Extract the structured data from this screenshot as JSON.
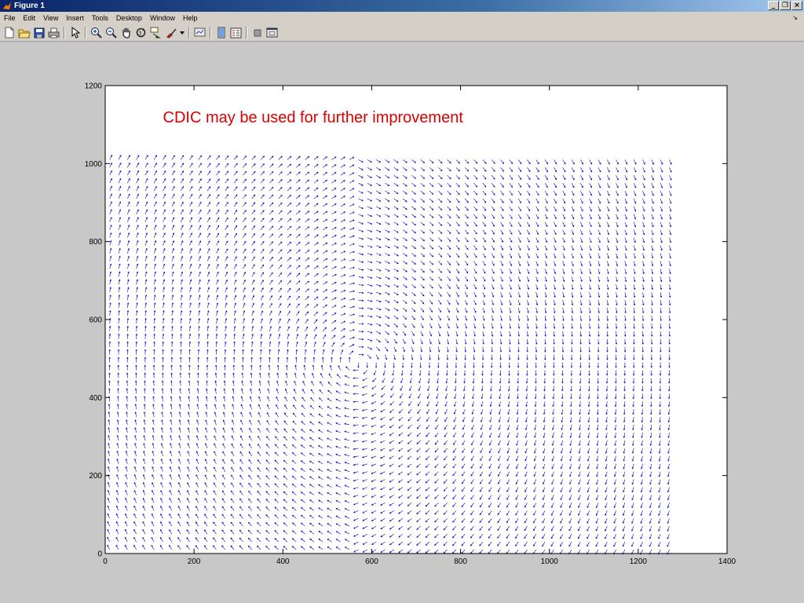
{
  "window": {
    "title": "Figure 1",
    "buttons": [
      "_",
      "❐",
      "×"
    ]
  },
  "menubar": {
    "items": [
      "File",
      "Edit",
      "View",
      "Insert",
      "Tools",
      "Desktop",
      "Window",
      "Help"
    ],
    "overflow_glyph": "↘"
  },
  "toolbar": {
    "buttons": [
      "new-figure-icon",
      "open-file-icon",
      "save-icon",
      "print-icon",
      "pointer-icon",
      "zoom-in-icon",
      "zoom-out-icon",
      "pan-hand-icon",
      "rotate-3d-icon",
      "data-cursor-icon",
      "brush-icon",
      "link-plot-icon",
      "colorbar-icon",
      "legend-icon",
      "hide-plot-tools-icon",
      "show-plot-tools-icon"
    ]
  },
  "colors": {
    "vectors": "#0000cc",
    "annotation": "#dd0000",
    "figure_bg": "#c8c8c8",
    "axes_bg": "#ffffff"
  },
  "chart_data": {
    "type": "quiver",
    "title": "",
    "xlabel": "",
    "ylabel": "",
    "xlim": [
      0,
      1400
    ],
    "ylim": [
      0,
      1200
    ],
    "xticks": [
      0,
      200,
      400,
      600,
      800,
      1000,
      1200,
      1400
    ],
    "yticks": [
      0,
      200,
      400,
      600,
      800,
      1000,
      1200
    ],
    "grid": false,
    "annotation": {
      "text": "CDIC may be used for further improvement",
      "x": 130,
      "y": 1105
    },
    "field": {
      "x_range": [
        10,
        1270
      ],
      "y_range": [
        10,
        1010
      ],
      "spacing": 20,
      "vortex_center": [
        570,
        490
      ],
      "rotation": "clockwise"
    }
  }
}
